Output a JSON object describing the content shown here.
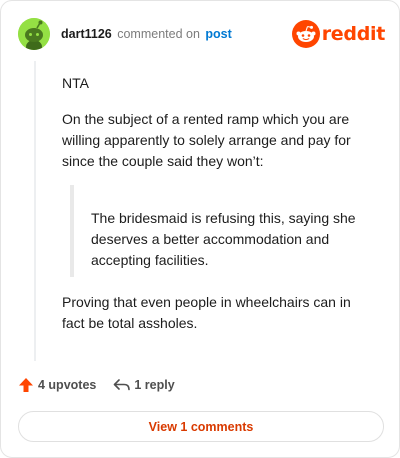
{
  "comment": {
    "username": "dart1126",
    "action_text": "commented on",
    "post_link": "post",
    "brand": "reddit",
    "paragraphs": {
      "p1": "NTA",
      "p2": "On the subject of a rented ramp which you are willing apparently to solely arrange and pay for since the couple said they won’t:",
      "quote": "The bridesmaid is refusing this, saying she deserves a better accommodation and accepting facilities.",
      "p3": "Proving that even people in wheelchairs can in fact be total assholes."
    },
    "upvotes_label": "4 upvotes",
    "replies_label": "1 reply",
    "view_comments_label": "View 1 comments"
  },
  "colors": {
    "brand": "#ff4500",
    "link": "#0079d3",
    "avatar_bg": "#94e044",
    "view_button_text": "#d93a00"
  },
  "icons": {
    "avatar": "snoo-avatar-icon",
    "logo": "reddit-logo-icon",
    "upvote": "upvote-arrow-icon",
    "reply": "reply-arrow-icon"
  }
}
